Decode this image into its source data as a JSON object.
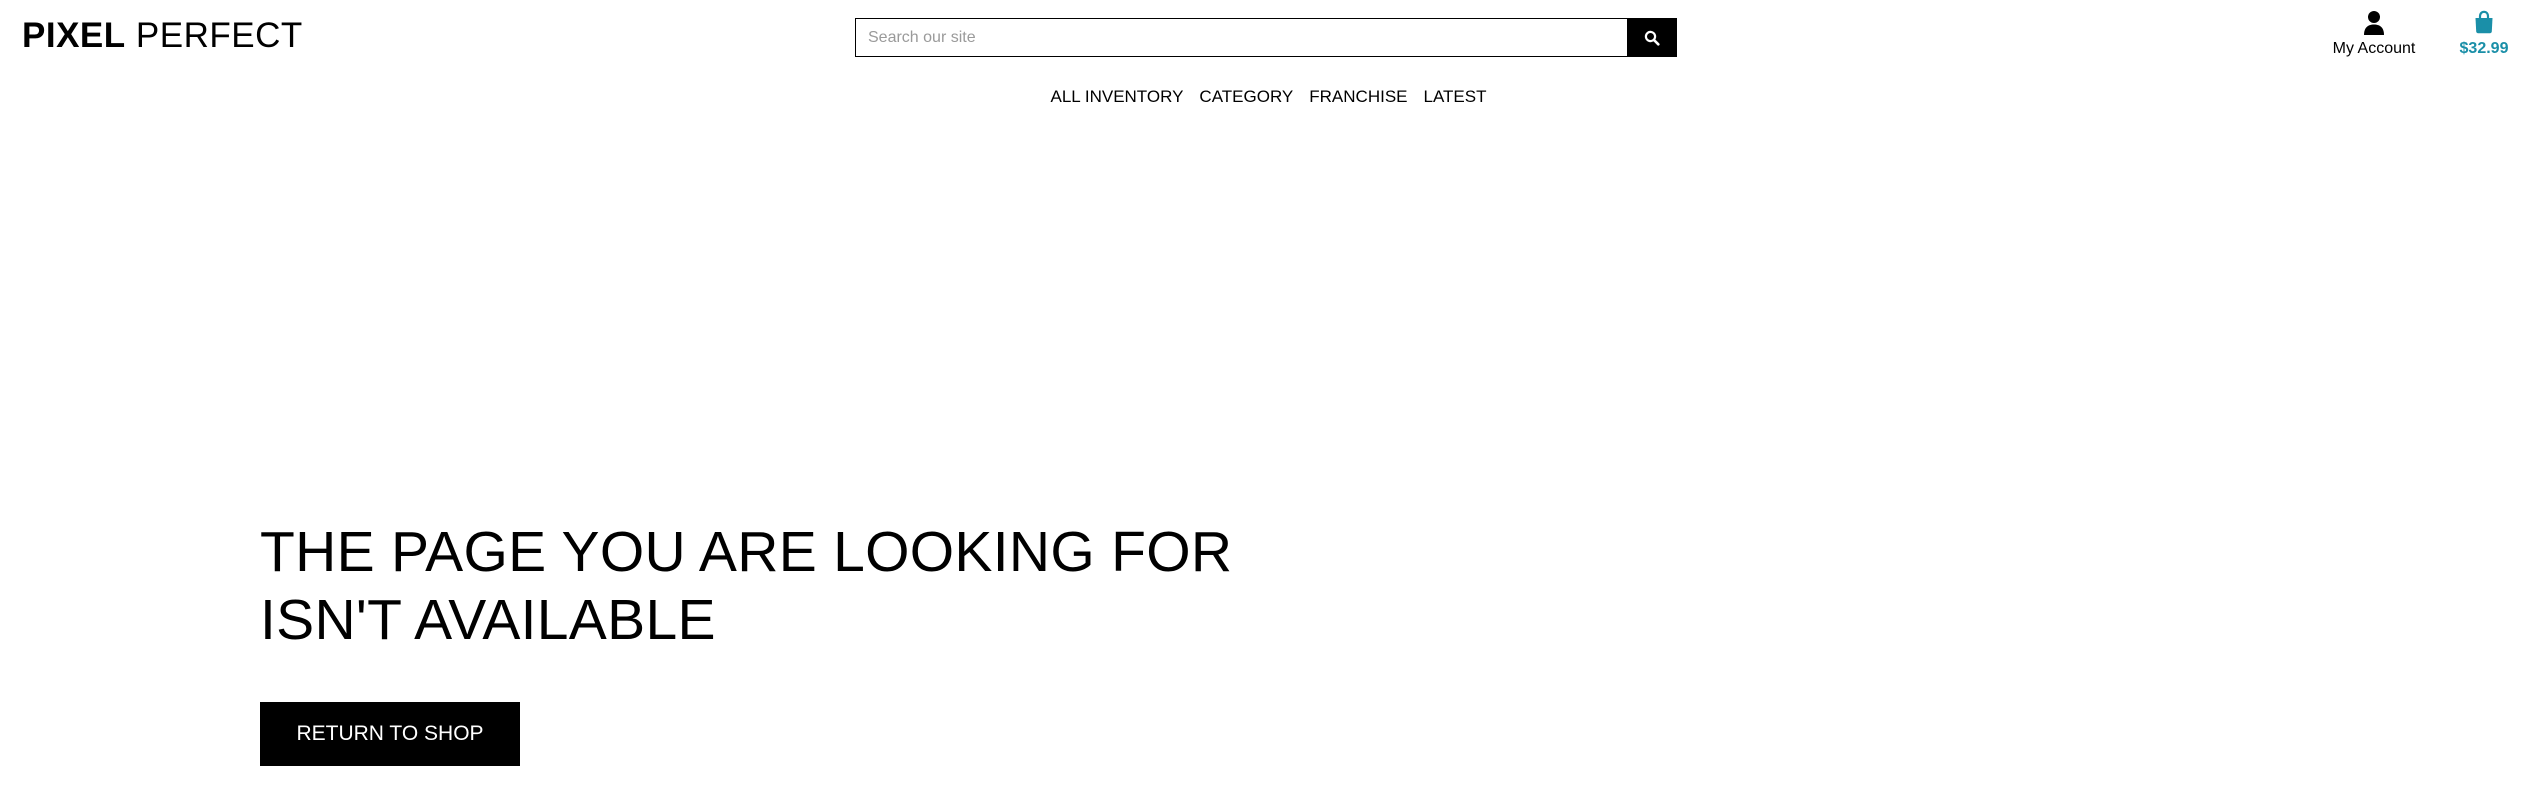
{
  "header": {
    "logo_bold": "PIXEL",
    "logo_light": "PERFECT",
    "search": {
      "placeholder": "Search our site",
      "button_icon": "search-icon"
    },
    "account": {
      "label": "My Account",
      "icon": "user-icon"
    },
    "cart": {
      "total": "$32.99",
      "icon": "shopping-bag-icon"
    }
  },
  "nav": {
    "items": [
      {
        "label": "ALL INVENTORY"
      },
      {
        "label": "CATEGORY"
      },
      {
        "label": "FRANCHISE"
      },
      {
        "label": "LATEST"
      }
    ]
  },
  "error": {
    "headline": "THE PAGE YOU ARE LOOKING FOR ISN'T AVAILABLE",
    "button_label": "RETURN TO SHOP"
  },
  "colors": {
    "background": "#ffffff",
    "text": "#000000",
    "accent": "#1a8fa8",
    "button_bg": "#000000",
    "button_text": "#ffffff"
  }
}
